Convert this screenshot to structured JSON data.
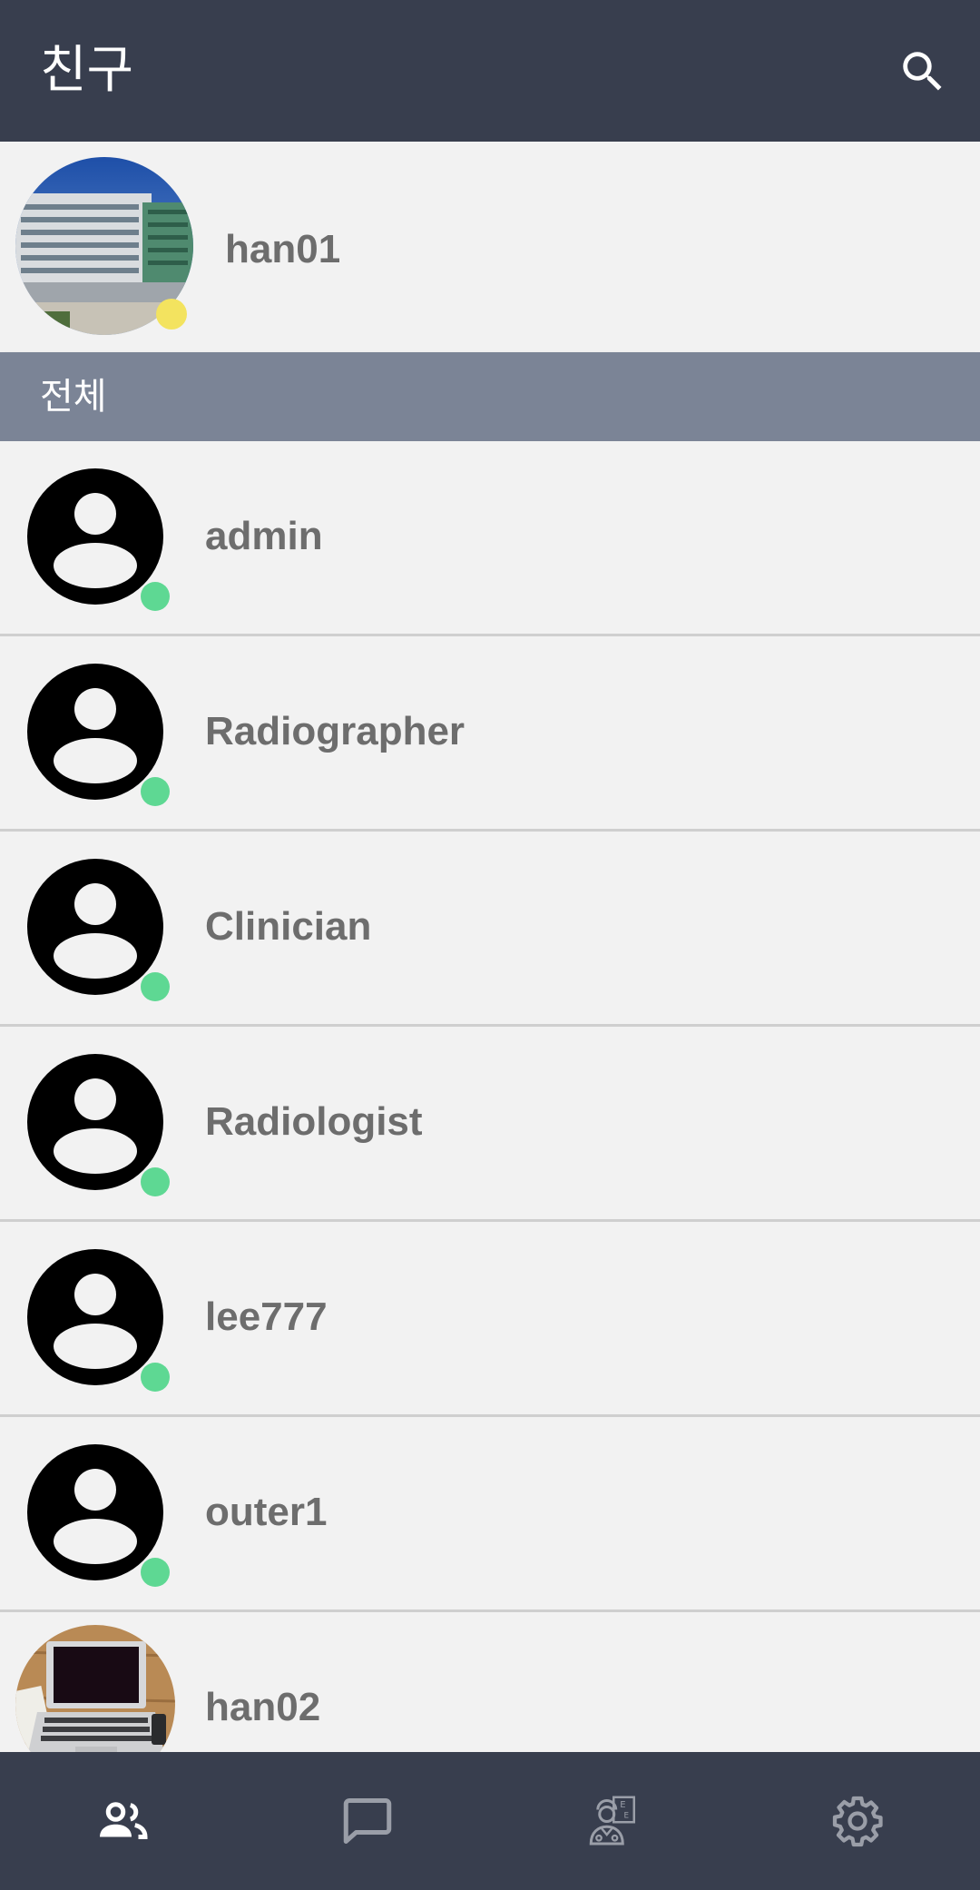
{
  "header": {
    "title": "친구",
    "search_icon": "search-icon"
  },
  "me": {
    "name": "han01",
    "status_color": "#f3e35f"
  },
  "section": {
    "label": "전체"
  },
  "friends": [
    {
      "name": "admin",
      "avatar": "default-avatar",
      "status_color": "#5ed893"
    },
    {
      "name": "Radiographer",
      "avatar": "default-avatar",
      "status_color": "#5ed893"
    },
    {
      "name": "Clinician",
      "avatar": "default-avatar",
      "status_color": "#5ed893"
    },
    {
      "name": "Radiologist",
      "avatar": "default-avatar",
      "status_color": "#5ed893"
    },
    {
      "name": "lee777",
      "avatar": "default-avatar",
      "status_color": "#5ed893"
    },
    {
      "name": "outer1",
      "avatar": "default-avatar",
      "status_color": "#5ed893"
    },
    {
      "name": "han02",
      "avatar": "photo-laptop",
      "status_color": "#5ed893"
    }
  ],
  "bottom_nav": [
    {
      "icon": "friends-icon",
      "active": true
    },
    {
      "icon": "chat-icon",
      "active": false
    },
    {
      "icon": "doctor-icon",
      "active": false
    },
    {
      "icon": "settings-icon",
      "active": false
    }
  ],
  "colors": {
    "appbar": "#383e4e",
    "section": "#7b8496",
    "online": "#5ed893",
    "away": "#f3e35f",
    "nav_active": "#ffffff",
    "nav_inactive": "#9a9ea8"
  }
}
